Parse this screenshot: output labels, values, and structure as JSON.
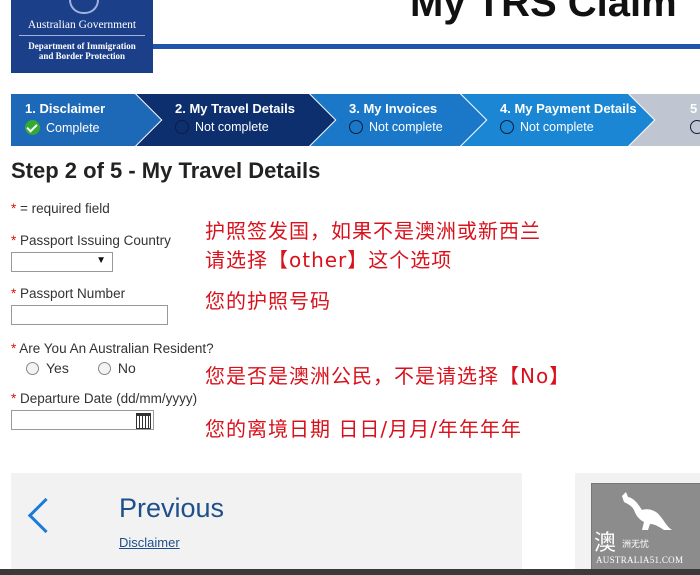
{
  "header": {
    "logo": {
      "government": "Australian Government",
      "department": [
        "Department of Immigration",
        "and Border Protection"
      ]
    },
    "title": "My TRS Claim"
  },
  "steps": [
    {
      "label": "1. Disclaimer",
      "status": "Complete",
      "status_icon": "check-icon",
      "color": "#1e69b7"
    },
    {
      "label": "2. My Travel Details",
      "status": "Not complete",
      "status_icon": "circle-icon",
      "color": "#0e2f6e"
    },
    {
      "label": "3. My Invoices",
      "status": "Not complete",
      "status_icon": "circle-icon",
      "color": "#1b78c8"
    },
    {
      "label": "4. My Payment Details",
      "status": "Not complete",
      "status_icon": "circle-icon",
      "color": "#1b86d3"
    },
    {
      "label": "5",
      "status": "",
      "status_icon": "circle-icon",
      "color": "#bfc6d1"
    }
  ],
  "form": {
    "step_title": "Step 2 of 5 - My Travel Details",
    "required_star": "*",
    "required_note": "= required field",
    "passport_country": {
      "label": "Passport Issuing Country",
      "value": ""
    },
    "passport_number": {
      "label": "Passport Number",
      "value": ""
    },
    "resident": {
      "label": "Are You An Australian Resident?",
      "options": [
        "Yes",
        "No"
      ]
    },
    "departure_date": {
      "label": "Departure Date (dd/mm/yyyy)",
      "value": ""
    }
  },
  "annotations": {
    "country_line1": "护照签发国，如果不是澳洲或新西兰",
    "country_line2": "请选择【other】这个选项",
    "passport_number": "您的护照号码",
    "resident": "您是否是澳洲公民，不是请选择【No】",
    "departure_date": "您的离境日期   日日/月月/年年年年"
  },
  "nav": {
    "previous_title": "Previous",
    "previous_link": "Disclaimer"
  },
  "watermark": {
    "big": "澳",
    "small": "洲无忧",
    "url": "AUSTRALIA51.COM"
  },
  "colors": {
    "annotation": "#d8121c",
    "accent": "#1e55a8"
  }
}
